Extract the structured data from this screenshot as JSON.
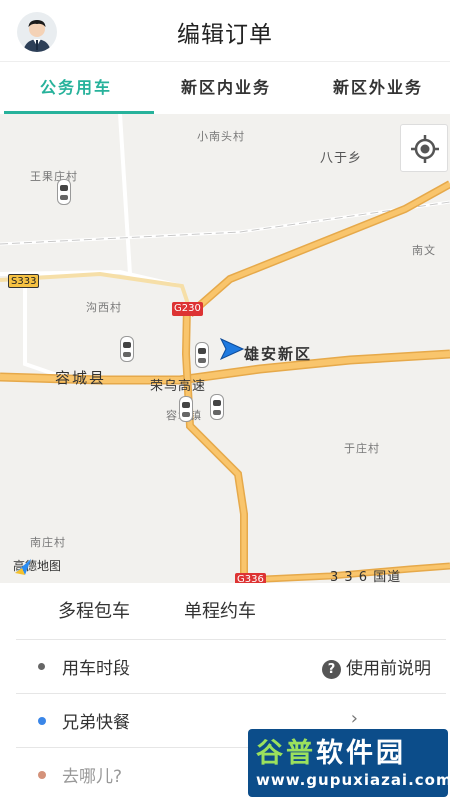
{
  "header": {
    "title": "编辑订单"
  },
  "tabs": [
    {
      "label": "公务用车",
      "active": true
    },
    {
      "label": "新区内业务",
      "active": false
    },
    {
      "label": "新区外业务",
      "active": false
    }
  ],
  "map": {
    "places": {
      "xiaonantou": "小南头村",
      "bayu": "八于乡",
      "wangguozhuang": "王果庄村",
      "nanwen": "南文",
      "gouxi": "沟西村",
      "xiongan": "雄安新区",
      "rongcheng_county": "容城县",
      "rongwu": "荣乌高速",
      "rongcheng_town": "容城镇",
      "yuzhuang": "于庄村",
      "nanzhuang": "南庄村",
      "guodao": "3 3 6 国道"
    },
    "road_shields": {
      "s333": "S333",
      "g230": "G230",
      "g336": "G336"
    },
    "provider": "高德地图",
    "colors": {
      "major_road": "#f9c56c",
      "map_bg": "#f2f1ee",
      "accent": "#27b29b"
    }
  },
  "trip_modes": {
    "multi": "多程包车",
    "single": "单程约车"
  },
  "form": {
    "time_label": "用车时段",
    "help_label": "使用前说明",
    "pickup_label": "兄弟快餐",
    "destination_placeholder": "去哪儿?",
    "chevron": "›"
  },
  "watermark": {
    "name_part1": "谷普",
    "name_part2": "软件园",
    "url": "www.gupuxiazai.com"
  }
}
